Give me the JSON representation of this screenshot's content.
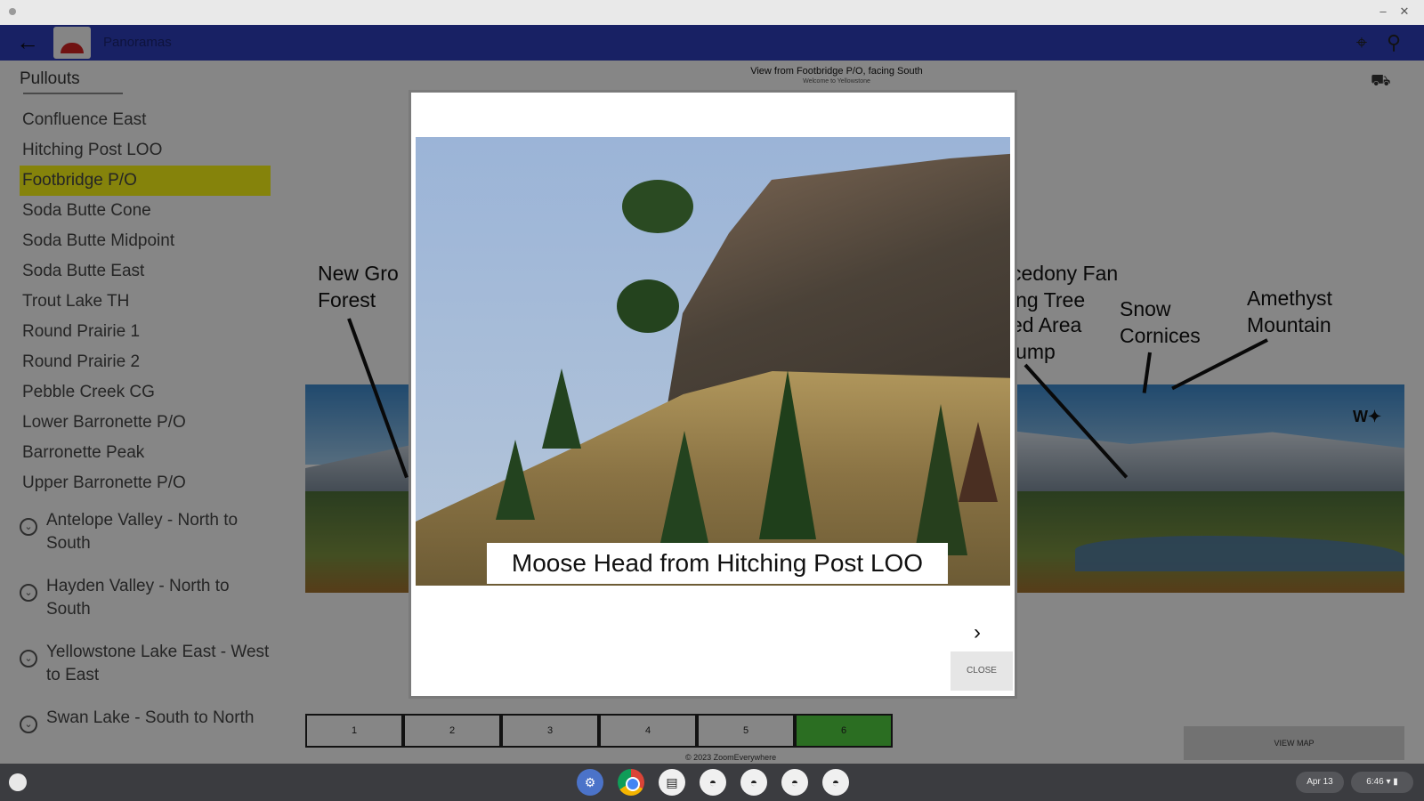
{
  "window": {
    "minimize_icon": "minimize-icon",
    "close_icon": "close-icon"
  },
  "app": {
    "title": "Panoramas",
    "back_icon": "arrow-back-icon",
    "pin_icon": "map-pin-icon",
    "hiker_icon": "hiker-icon"
  },
  "sidebar": {
    "title": "Pullouts",
    "items": [
      "Confluence East",
      "Hitching Post LOO",
      "Footbridge P/O",
      "Soda Butte Cone",
      "Soda Butte Midpoint",
      "Soda Butte East",
      "Trout Lake TH",
      "Round Prairie 1",
      "Round Prairie 2",
      "Pebble Creek CG",
      "Lower Barronette P/O",
      "Barronette Peak",
      "Upper Barronette P/O"
    ],
    "active_item": "Footbridge P/O",
    "groups": [
      "Antelope Valley - North to South",
      "Hayden Valley - North to South",
      "Yellowstone Lake East - West to East",
      "Swan Lake - South to North"
    ]
  },
  "view": {
    "caption": "View from Footbridge P/O, facing South",
    "subcaption": "Welcome to Yellowstone",
    "annotations": {
      "a1": "New Gro",
      "a2": "Forest",
      "a3": "cedony Fan",
      "a4": "ing Tree",
      "a5": "ed Area",
      "a6": "lump",
      "a7": "Snow",
      "a8": "Cornices",
      "a9": "Amethyst",
      "a10": "Mountain"
    },
    "compass": "W"
  },
  "pager": {
    "pages": [
      "1",
      "2",
      "3",
      "4",
      "5",
      "6"
    ],
    "active_page": "6"
  },
  "footer": {
    "copyright": "© 2023 ZoomEverywhere",
    "map_button": "VIEW MAP"
  },
  "modal": {
    "caption": "Moose Head from Hitching Post LOO",
    "next_icon": "chevron-right-icon",
    "close_label": "CLOSE"
  },
  "shelf": {
    "apps": [
      "settings-icon",
      "chrome-icon",
      "files-icon",
      "app-icon",
      "app-icon",
      "app-icon",
      "app-icon"
    ],
    "date": "Apr 13",
    "time": "6:46"
  },
  "colors": {
    "appbar": "#2c3cb7",
    "active_item": "#f2ef14",
    "active_page": "#4fc83e",
    "overlay": "rgba(0,0,0,0.45)"
  }
}
